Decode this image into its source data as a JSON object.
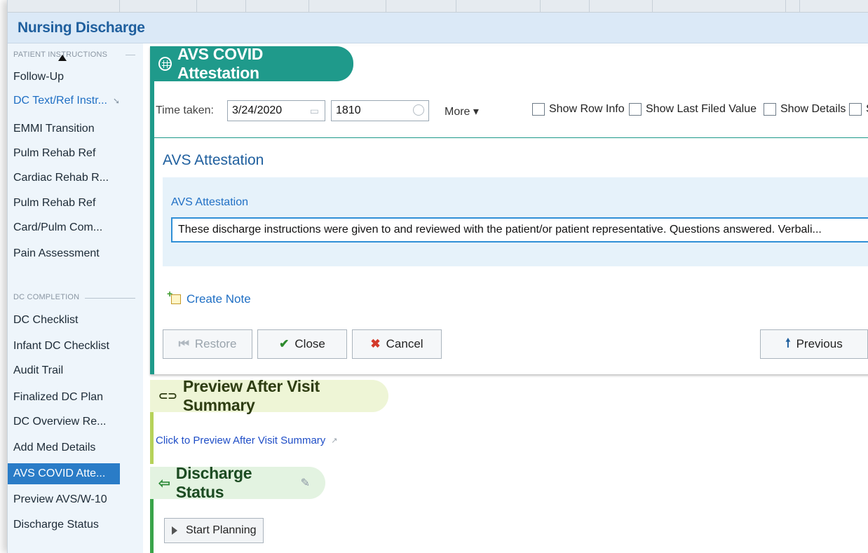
{
  "window": {
    "title": "Nursing Discharge"
  },
  "sidebar": {
    "section_patient_instructions": "PATIENT INSTRUCTIONS",
    "section_dc_completion": "DC COMPLETION",
    "items": [
      {
        "label": "Follow-Up"
      },
      {
        "label": "DC Text/Ref Instr...",
        "icon": "pin-icon"
      },
      {
        "label": "EMMI Transition"
      },
      {
        "label": "Pulm Rehab Ref"
      },
      {
        "label": "Cardiac Rehab R..."
      },
      {
        "label": "Pulm Rehab Ref"
      },
      {
        "label": "Card/Pulm Com..."
      },
      {
        "label": "Pain Assessment"
      }
    ],
    "completion_items": [
      {
        "label": "DC Checklist"
      },
      {
        "label": "Infant DC Checklist"
      },
      {
        "label": "Audit Trail"
      },
      {
        "label": "Finalized DC Plan"
      },
      {
        "label": "DC Overview Re..."
      },
      {
        "label": "Add Med Details"
      },
      {
        "label": "AVS COVID Atte...",
        "selected": true
      },
      {
        "label": "Preview AVS/W-10"
      },
      {
        "label": "Discharge Status"
      }
    ]
  },
  "avs_card": {
    "title": "AVS COVID Attestation",
    "icon": "table-grid-icon",
    "accent_color": "#1f9a8b",
    "toolbar": {
      "time_taken_label": "Time taken:",
      "date_value": "3/24/2020",
      "time_value": "1810",
      "more_label": "More ▾",
      "checkboxes": [
        "Show Row Info",
        "Show Last Filed Value",
        "Show Details",
        "S"
      ]
    },
    "section_title": "AVS Attestation",
    "field_label": "AVS Attestation",
    "field_value": "These discharge instructions were given to and reviewed with the patient/or patient representative. Questions answered. Verbali...",
    "create_note_label": "Create Note",
    "buttons": {
      "restore": "Restore",
      "close": "Close",
      "cancel": "Cancel",
      "previous": "Previous"
    }
  },
  "preview_card": {
    "title": "Preview After Visit Summary",
    "icon": "link-icon",
    "link_label": "Click to Preview After Visit Summary"
  },
  "discharge_card": {
    "title": "Discharge Status",
    "icon": "exit-icon",
    "edit_icon": "pencil-icon",
    "start_button": "Start Planning"
  }
}
